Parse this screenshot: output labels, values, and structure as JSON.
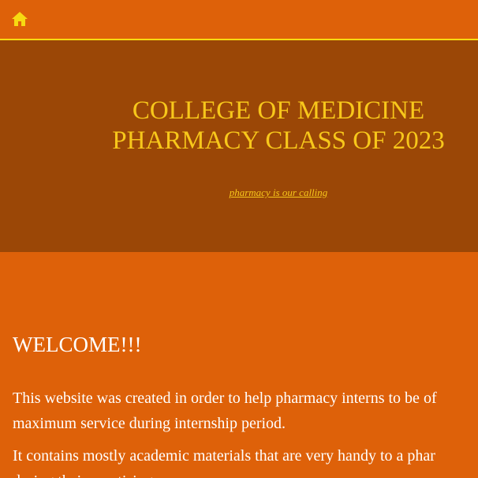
{
  "nav": {
    "home_icon": "home-icon"
  },
  "hero": {
    "title_line1": "COLLEGE OF MEDICINE",
    "title_line2": "PHARMACY CLASS OF 2023",
    "tagline": "pharmacy is our calling"
  },
  "content": {
    "heading": "WELCOME!!!",
    "paragraph1_line1": "This website was created in order to help pharmacy interns to be of",
    "paragraph1_line2": "maximum service during internship period.",
    "paragraph2_line1": "It contains mostly academic materials that are very handy to a phar",
    "paragraph2_line2": "during their practising."
  },
  "colors": {
    "page_background": "#DE6109",
    "hero_background": "#9B4706",
    "accent_yellow": "#F7DA12",
    "hero_text": "#F7C71B",
    "body_text": "#FFFFFF"
  }
}
